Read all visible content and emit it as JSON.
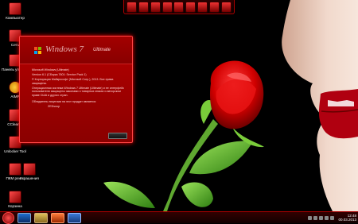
{
  "desktop": {
    "icons": [
      {
        "label": "Компьютер",
        "icon": "computer-icon"
      },
      {
        "label": "Сеть",
        "icon": "network-icon"
      },
      {
        "label": "Панель управл...",
        "icon": "control-panel-icon"
      },
      {
        "label": "AIMP",
        "icon": "aimp-icon"
      },
      {
        "label": "CCleaner",
        "icon": "ccleaner-icon"
      },
      {
        "label": "Unlocker Tool",
        "icon": "unlocker-icon"
      },
      {
        "label": "ПКМ реж...",
        "icon": "shortcut-icon"
      },
      {
        "label": "Украшения",
        "icon": "decoration-icon"
      },
      {
        "label": "Корзина",
        "icon": "recycle-bin-icon"
      }
    ]
  },
  "topdock": {
    "icons": [
      "app-icon",
      "app-icon",
      "app-icon",
      "app-icon",
      "app-icon",
      "app-icon",
      "app-icon",
      "app-icon",
      "app-icon"
    ]
  },
  "about_window": {
    "brand": "Windows 7",
    "edition": "Ultimate",
    "line1": "Microsoft Windows (Ultimate)",
    "line2": "Version 6.1 (Сборка 7601: Service Pack 1)",
    "line3": "© Корпорация Майкрософт (Microsoft Corp.), 2013. Все права защищены.",
    "line4": "Операционная система Windows 7 Ultimate (Ultimate) и ее интерфейс пользователя защищены законами о товарных знаках и авторском праве США и других стран.",
    "line5": "Обладатель лицензии на этот продукт является:",
    "line6": "ZEDsoup"
  },
  "taskbar": {
    "buttons": [
      "ie-icon",
      "folder-icon",
      "media-icon",
      "windows-icon"
    ],
    "clock_time": "12:48",
    "clock_date": "00.03.2013"
  },
  "colors": {
    "accent": "#cc0000",
    "window": "#a30000"
  }
}
